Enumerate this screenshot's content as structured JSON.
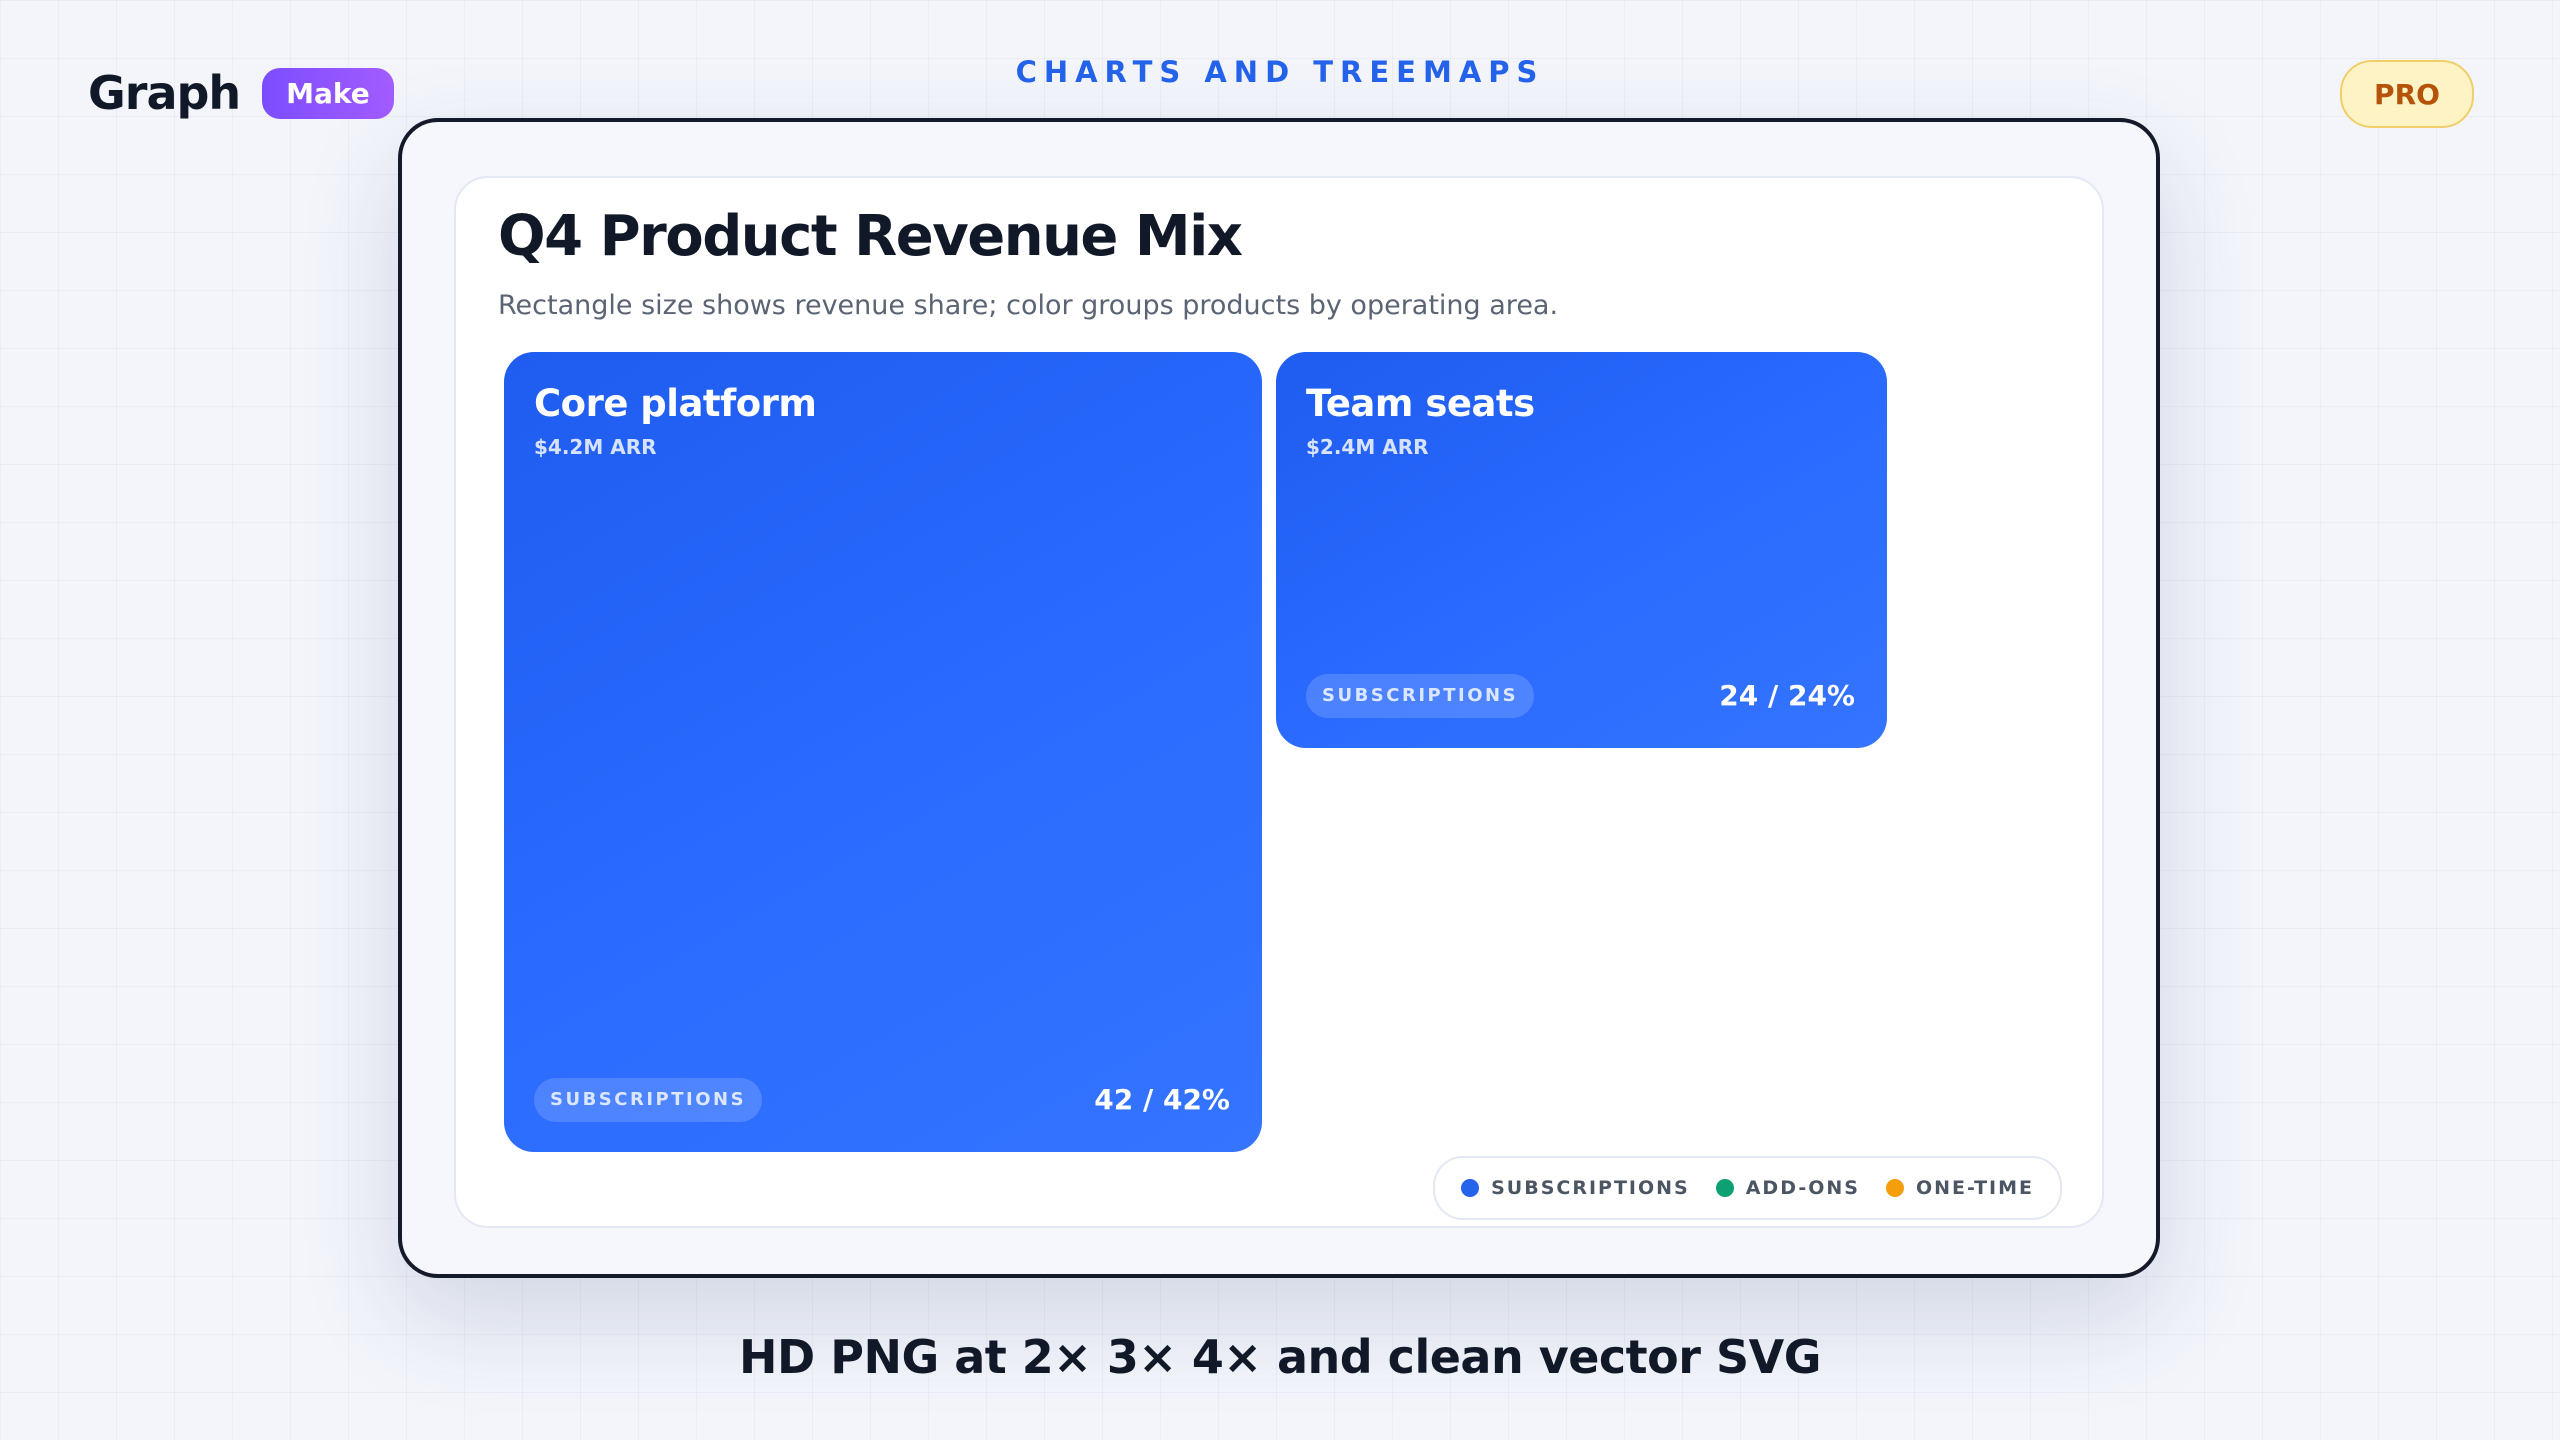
{
  "brand": {
    "name": "Graph",
    "badge": "Make"
  },
  "header": {
    "title": "CHARTS AND TREEMAPS",
    "pro_label": "PRO"
  },
  "footer": {
    "caption": "HD PNG at 2× 3× 4× and clean vector SVG"
  },
  "colors": {
    "accent": "#2563eb",
    "subscriptions": "#2563eb",
    "add_ons": "#0e9f73",
    "one_time": "#f59e0b"
  },
  "chart_data": {
    "type": "treemap",
    "title": "Q4 Product Revenue Mix",
    "subtitle": "Rectangle size shows revenue share; color groups products by operating area.",
    "items": [
      {
        "name": "Core platform",
        "value_label": "$4.2M ARR",
        "value": 42,
        "share_label": "42 / 42%",
        "group": "SUBSCRIPTIONS"
      },
      {
        "name": "Team seats",
        "value_label": "$2.4M ARR",
        "value": 24,
        "share_label": "24 / 24%",
        "group": "SUBSCRIPTIONS"
      }
    ],
    "legend": [
      {
        "label": "SUBSCRIPTIONS",
        "color": "#2563eb"
      },
      {
        "label": "ADD-ONS",
        "color": "#0e9f73"
      },
      {
        "label": "ONE-TIME",
        "color": "#f59e0b"
      }
    ],
    "legend_position": "bottom-right"
  }
}
